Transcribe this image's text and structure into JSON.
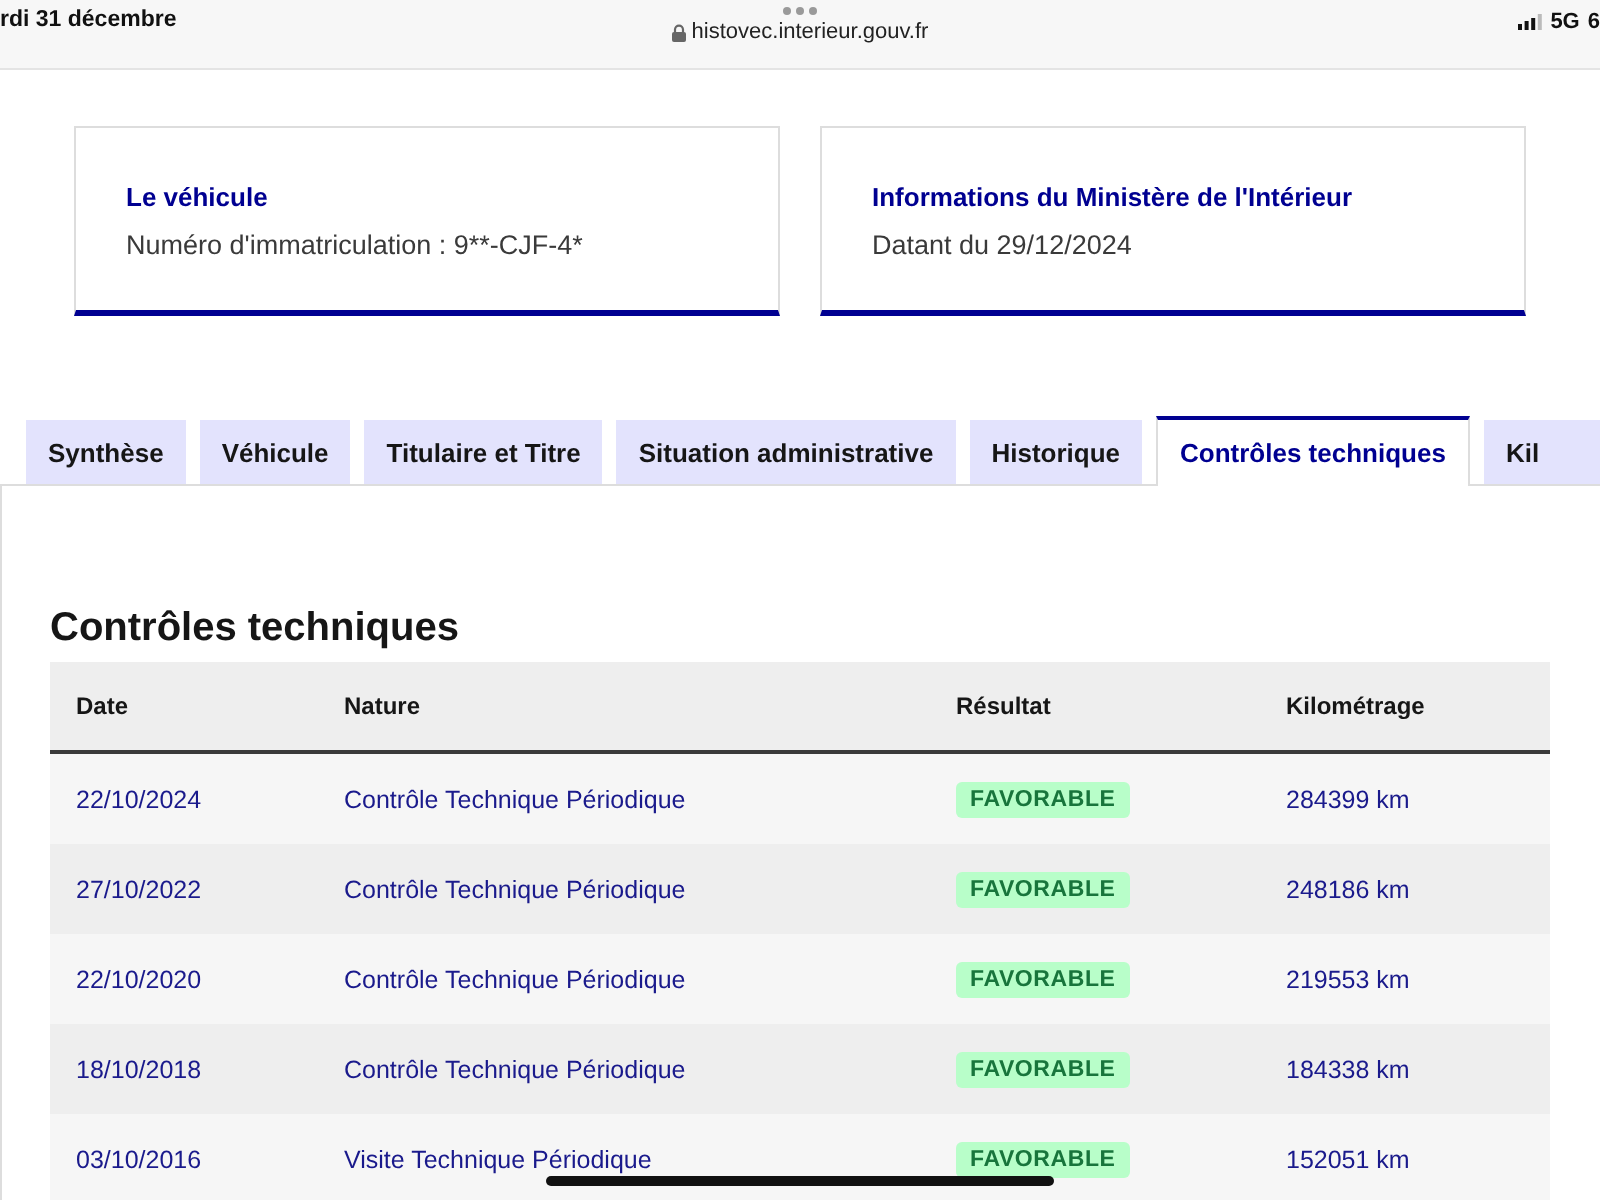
{
  "status_bar": {
    "date": "rdi 31 décembre",
    "url": "histovec.interieur.gouv.fr",
    "network": "5G",
    "battery": "6"
  },
  "cards": [
    {
      "title": "Le véhicule",
      "text": "Numéro d'immatriculation : 9**-CJF-4*"
    },
    {
      "title": "Informations du Ministère de l'Intérieur",
      "text": "Datant du 29/12/2024"
    }
  ],
  "tabs": [
    {
      "label": "Synthèse",
      "selected": false
    },
    {
      "label": "Véhicule",
      "selected": false
    },
    {
      "label": "Titulaire et Titre",
      "selected": false
    },
    {
      "label": "Situation administrative",
      "selected": false
    },
    {
      "label": "Historique",
      "selected": false
    },
    {
      "label": "Contrôles techniques",
      "selected": true
    },
    {
      "label": "Kil",
      "selected": false
    }
  ],
  "section": {
    "title": "Contrôles techniques",
    "table": {
      "columns": [
        "Date",
        "Nature",
        "Résultat",
        "Kilométrage"
      ],
      "rows": [
        {
          "date": "22/10/2024",
          "nature": "Contrôle Technique Périodique",
          "result": "FAVORABLE",
          "mileage": "284399 km"
        },
        {
          "date": "27/10/2022",
          "nature": "Contrôle Technique Périodique",
          "result": "FAVORABLE",
          "mileage": "248186 km"
        },
        {
          "date": "22/10/2020",
          "nature": "Contrôle Technique Périodique",
          "result": "FAVORABLE",
          "mileage": "219553 km"
        },
        {
          "date": "18/10/2018",
          "nature": "Contrôle Technique Périodique",
          "result": "FAVORABLE",
          "mileage": "184338 km"
        },
        {
          "date": "03/10/2016",
          "nature": "Visite Technique Périodique",
          "result": "FAVORABLE",
          "mileage": "152051 km"
        }
      ]
    }
  }
}
